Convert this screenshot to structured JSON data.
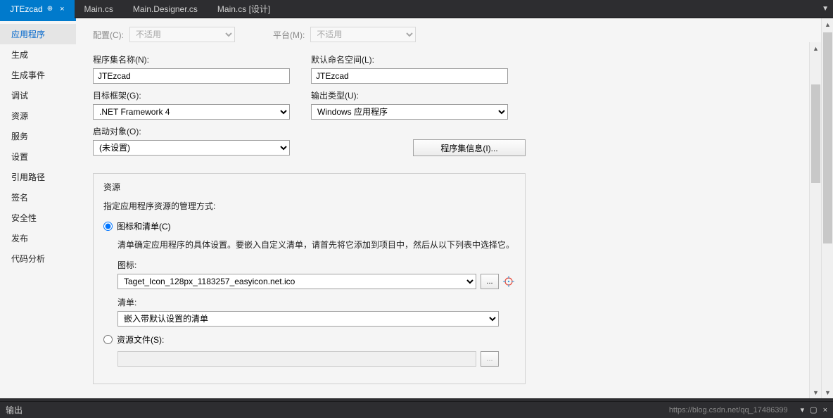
{
  "tabs": [
    {
      "label": "JTEzcad",
      "active": true,
      "pinned": true
    },
    {
      "label": "Main.cs",
      "active": false
    },
    {
      "label": "Main.Designer.cs",
      "active": false
    },
    {
      "label": "Main.cs [设计]",
      "active": false
    }
  ],
  "sidebar": {
    "items": [
      "应用程序",
      "生成",
      "生成事件",
      "调试",
      "资源",
      "服务",
      "设置",
      "引用路径",
      "签名",
      "安全性",
      "发布",
      "代码分析"
    ],
    "activeIndex": 0
  },
  "config": {
    "configLabel": "配置(C):",
    "configValue": "不适用",
    "platformLabel": "平台(M):",
    "platformValue": "不适用"
  },
  "form": {
    "assemblyNameLabel": "程序集名称(N):",
    "assemblyName": "JTEzcad",
    "defaultNamespaceLabel": "默认命名空间(L):",
    "defaultNamespace": "JTEzcad",
    "targetFrameworkLabel": "目标框架(G):",
    "targetFramework": ".NET Framework 4",
    "outputTypeLabel": "输出类型(U):",
    "outputType": "Windows 应用程序",
    "startupObjectLabel": "启动对象(O):",
    "startupObject": "(未设置)",
    "assemblyInfoButton": "程序集信息(I)..."
  },
  "resources": {
    "title": "资源",
    "desc": "指定应用程序资源的管理方式:",
    "iconManifestLabel": "图标和清单(C)",
    "iconManifestDesc": "清单确定应用程序的具体设置。要嵌入自定义清单，请首先将它添加到项目中，然后从以下列表中选择它。",
    "iconLabel": "图标:",
    "iconValue": "Taget_Icon_128px_1183257_easyicon.net.ico",
    "browseBtn": "...",
    "manifestLabel": "清单:",
    "manifestValue": "嵌入带默认设置的清单",
    "resourceFileLabel": "资源文件(S):"
  },
  "bottomBar": {
    "output": "输出",
    "watermark": "https://blog.csdn.net/qq_17486399"
  }
}
